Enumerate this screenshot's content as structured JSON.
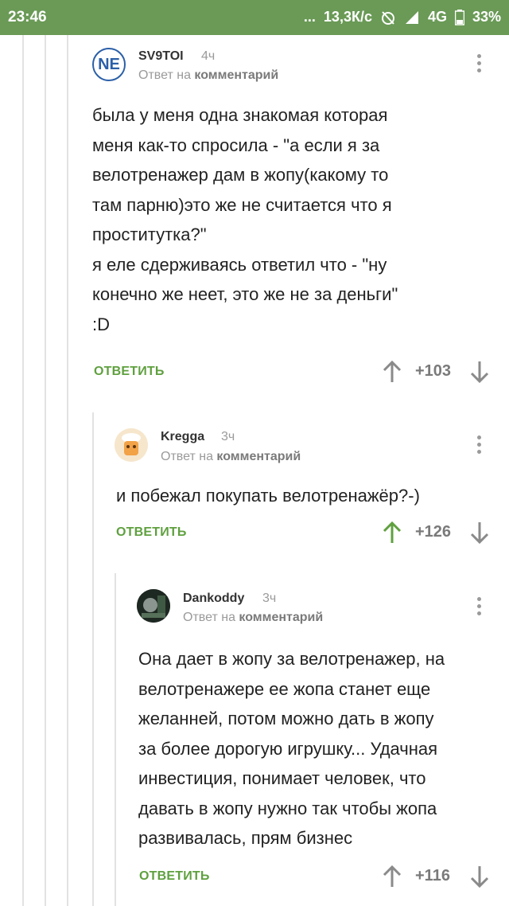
{
  "status_bar": {
    "time": "23:46",
    "dots": "...",
    "speed": "13,3К/с",
    "network": "4G",
    "battery": "33%"
  },
  "comments": [
    {
      "avatar_text": "NE",
      "username": "SV9TOI",
      "time": "4ч",
      "reply_prefix": "Ответ на",
      "reply_target": "комментарий",
      "text": "была у меня одна знакомая которая\nменя как-то спросила - \"а если я за\nвелотренажер дам в жопу(какому то\nтам парню)это же не считается что я\nпроститутка?\"\nя еле сдерживаясь ответил что - \"ну\nконечно же неет, это же не за деньги\"\n:D",
      "reply_label": "ОТВЕТИТЬ",
      "rating": "+103",
      "upvoted": false
    },
    {
      "username": "Kregga",
      "time": "3ч",
      "reply_prefix": "Ответ на",
      "reply_target": "комментарий",
      "text": "и побежал покупать велотренажёр?-)",
      "reply_label": "ОТВЕТИТЬ",
      "rating": "+126",
      "upvoted": true
    },
    {
      "username": "Dankoddy",
      "time": "3ч",
      "reply_prefix": "Ответ на",
      "reply_target": "комментарий",
      "text": "Она дает в жопу за велотренажер, на\nвелотренажере ее жопа станет еще\nжеланней, потом можно дать в жопу\nза более дорогую игрушку... Удачная\nинвестиция, понимает человек, что\nдавать в жопу нужно так чтобы жопа\nразвивалась, прям бизнес",
      "reply_label": "ОТВЕТИТЬ",
      "rating": "+116",
      "upvoted": false
    }
  ],
  "colors": {
    "status_bar": "#6a9a56",
    "accent_green": "#5fa03f",
    "muted": "#9a9a9a"
  }
}
